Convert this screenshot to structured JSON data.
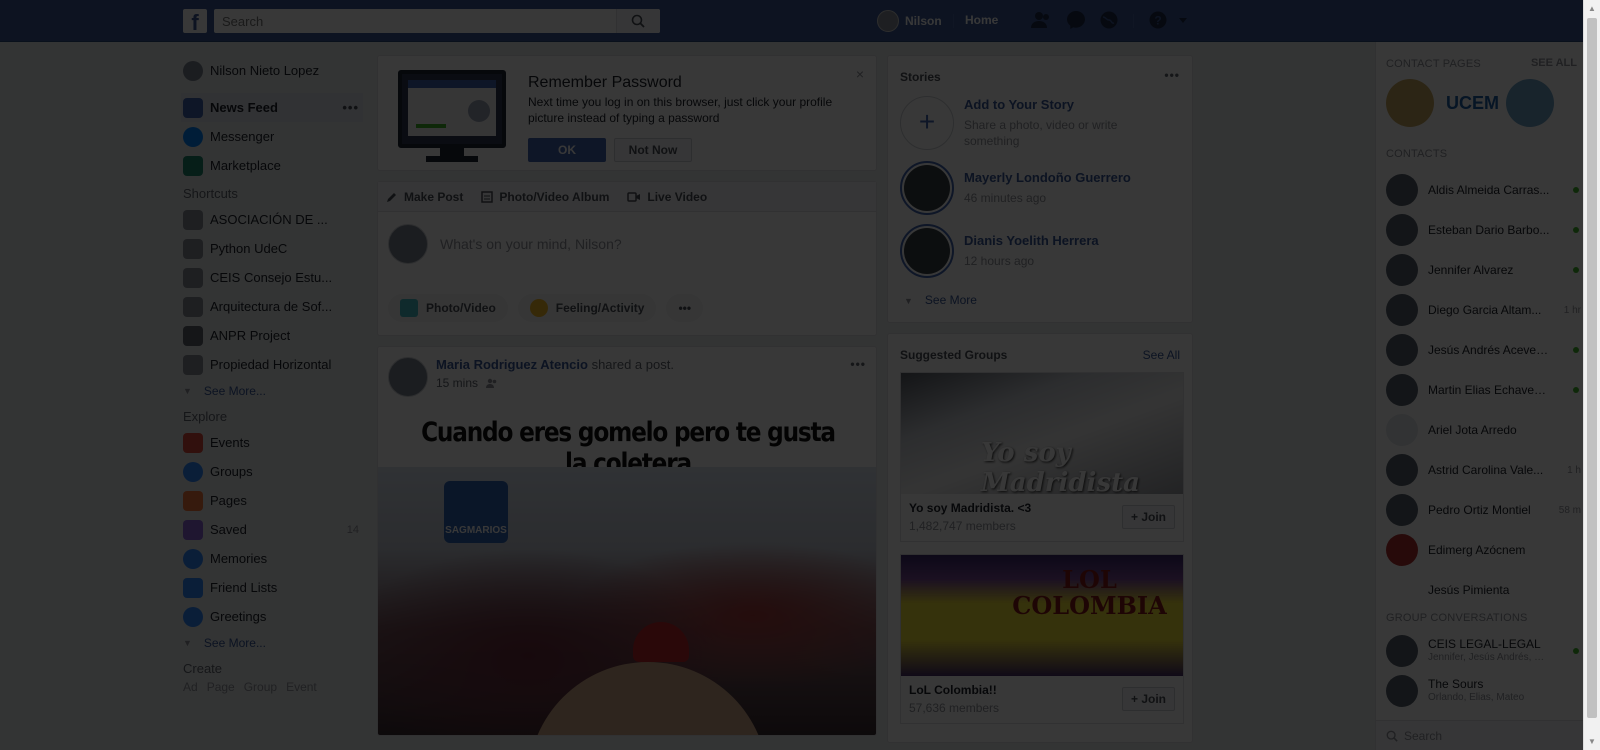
{
  "topbar": {
    "logo": "f",
    "search_placeholder": "Search",
    "user_name": "Nilson",
    "home_label": "Home",
    "icons": [
      "friend-requests-icon",
      "messenger-icon",
      "notifications-globe-icon",
      "help-icon",
      "account-menu-arrow-icon"
    ]
  },
  "left": {
    "profile_name": "Nilson Nieto Lopez",
    "main_items": [
      {
        "label": "News Feed",
        "icon": "news-feed-icon",
        "color": "#4267b2"
      },
      {
        "label": "Messenger",
        "icon": "messenger-icon",
        "color": "#0084ff"
      },
      {
        "label": "Marketplace",
        "icon": "marketplace-icon",
        "color": "#1f8a70"
      }
    ],
    "more_dots": "•••",
    "shortcuts_title": "Shortcuts",
    "shortcuts": [
      {
        "label": "ASOCIACIÓN DE ..."
      },
      {
        "label": "Python UdeC"
      },
      {
        "label": "CEIS Consejo Estu..."
      },
      {
        "label": "Arquitectura de Sof..."
      },
      {
        "label": "ANPR Project"
      },
      {
        "label": "Propiedad Horizontal"
      }
    ],
    "shortcuts_see_more": "See More...",
    "explore_title": "Explore",
    "explore": [
      {
        "label": "Events",
        "icon": "events-calendar-icon",
        "color": "#e04b3b",
        "count": ""
      },
      {
        "label": "Groups",
        "icon": "groups-icon",
        "color": "#2d88ff",
        "count": ""
      },
      {
        "label": "Pages",
        "icon": "pages-flag-icon",
        "color": "#f5793b",
        "count": ""
      },
      {
        "label": "Saved",
        "icon": "saved-bookmark-icon",
        "color": "#8c64d8",
        "count": "14"
      },
      {
        "label": "Memories",
        "icon": "memories-clock-icon",
        "color": "#2d88ff",
        "count": ""
      },
      {
        "label": "Friend Lists",
        "icon": "friend-lists-icon",
        "color": "#2d88ff",
        "count": ""
      },
      {
        "label": "Greetings",
        "icon": "greetings-icon",
        "color": "#2d88ff",
        "count": ""
      }
    ],
    "explore_see_more": "See More...",
    "create_title": "Create",
    "create_links": [
      "Ad",
      "Page",
      "Group",
      "Event"
    ]
  },
  "remember": {
    "title": "Remember Password",
    "desc": "Next time you log in on this browser, just click your profile picture instead of typing a password",
    "ok_label": "OK",
    "not_now_label": "Not Now",
    "close": "×"
  },
  "composer": {
    "tabs": [
      {
        "label": "Make Post",
        "icon": "pencil-icon"
      },
      {
        "label": "Photo/Video Album",
        "icon": "album-icon"
      },
      {
        "label": "Live Video",
        "icon": "live-video-icon"
      }
    ],
    "placeholder": "What's on your mind, Nilson?",
    "actions": [
      {
        "label": "Photo/Video",
        "icon": "photo-video-icon",
        "color": "#44bec7"
      },
      {
        "label": "Feeling/Activity",
        "icon": "feeling-emoji-icon",
        "color": "#f7b928"
      }
    ],
    "more": "•••"
  },
  "post": {
    "author": "Maria Rodriguez Atencio",
    "action": "shared a post.",
    "time": "15 mins",
    "caption": "Cuando eres gomelo pero te gusta la coletera",
    "image_logo_text": "SAGMARIOS",
    "dots": "•••"
  },
  "stories": {
    "title": "Stories",
    "dots": "•••",
    "add_title": "Add to Your Story",
    "add_sub": "Share a photo, video or write something",
    "items": [
      {
        "name": "Mayerly Londoño Guerrero",
        "time": "46 minutes ago"
      },
      {
        "name": "Dianis Yoelith Herrera",
        "time": "12 hours ago"
      }
    ],
    "see_more": "See More"
  },
  "groups": {
    "title": "Suggested Groups",
    "see_all": "See All",
    "items": [
      {
        "name": "Yo soy Madridista. <3",
        "members": "1,482,747 members",
        "overlay": "Yo soy Madridista",
        "join": "+ Join"
      },
      {
        "name": "LoL Colombia!!",
        "members": "57,636 members",
        "overlay": "LOL COLOMBIA",
        "join": "+ Join"
      }
    ]
  },
  "chat": {
    "contact_pages_title": "CONTACT PAGES",
    "see_all": "SEE ALL",
    "page_b_label": "UCEM",
    "contacts_title": "CONTACTS",
    "contacts": [
      {
        "name": "Aldis Almeida Carras...",
        "status": "online",
        "time": ""
      },
      {
        "name": "Esteban Dario Barbo...",
        "status": "online",
        "time": ""
      },
      {
        "name": "Jennifer Alvarez",
        "status": "online",
        "time": ""
      },
      {
        "name": "Diego Garcia Altam...",
        "status": "",
        "time": "1 hr"
      },
      {
        "name": "Jesús Andrés Acevedo...",
        "status": "online",
        "time": ""
      },
      {
        "name": "Martin Elias Echavez...",
        "status": "online",
        "time": ""
      },
      {
        "name": "Ariel Jota Arredo",
        "status": "",
        "time": ""
      },
      {
        "name": "Astrid Carolina Vale...",
        "status": "",
        "time": "1 h"
      },
      {
        "name": "Pedro Ortiz Montiel",
        "status": "",
        "time": "58 m"
      },
      {
        "name": "Edimerg Azócnem",
        "status": "",
        "time": ""
      },
      {
        "name": "Jesús Pimienta",
        "status": "",
        "time": ""
      }
    ],
    "group_conv_title": "GROUP CONVERSATIONS",
    "groups": [
      {
        "name": "CEIS LEGAL-LEGAL",
        "members": "Jennifer, Jesús Andrés, Er...",
        "status": "online"
      },
      {
        "name": "The Sours",
        "members": "Orlando, Elias, Mateo",
        "status": ""
      }
    ],
    "search_placeholder": "Search"
  },
  "colors": {
    "brand": "#3b5998",
    "overlay": "rgba(0,0,0,0.78)"
  }
}
